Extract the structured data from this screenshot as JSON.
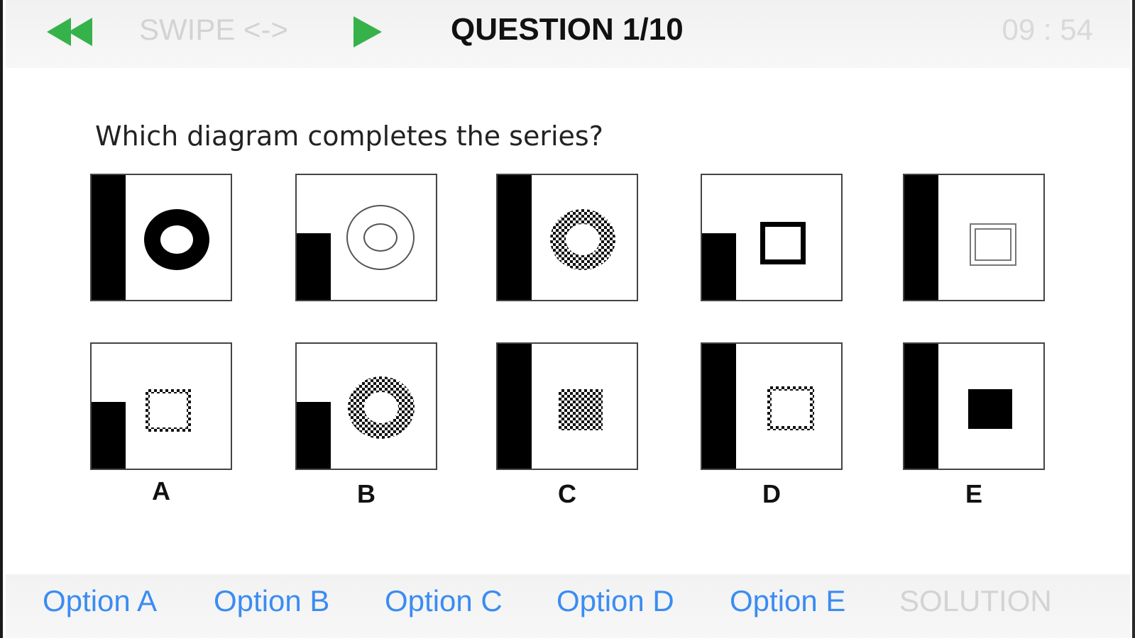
{
  "header": {
    "swipe_label": "SWIPE <->",
    "question_title": "QUESTION 1/10",
    "timer": "09 : 54",
    "icons": {
      "back": "rewind-icon",
      "play": "play-icon"
    },
    "accent_color": "#36b24a"
  },
  "question": {
    "prompt": "Which diagram completes the series?"
  },
  "options": [
    {
      "letter": "A"
    },
    {
      "letter": "B"
    },
    {
      "letter": "C"
    },
    {
      "letter": "D"
    },
    {
      "letter": "E"
    }
  ],
  "bottom_bar": {
    "option_buttons": [
      "Option A",
      "Option B",
      "Option C",
      "Option D",
      "Option E"
    ],
    "solution_label": "SOLUTION",
    "link_color": "#3a8cf2"
  }
}
